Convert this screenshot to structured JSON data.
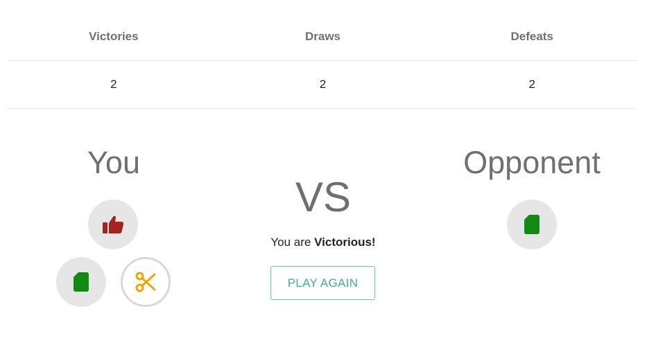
{
  "scoreboard": {
    "headers": [
      "Victories",
      "Draws",
      "Defeats"
    ],
    "values": [
      "2",
      "2",
      "2"
    ]
  },
  "players": {
    "you_title": "You",
    "opponent_title": "Opponent",
    "you_choices": [
      {
        "icon": "thumbs-up-icon",
        "color": "#a3241f"
      },
      {
        "icon": "paper-icon",
        "color": "#138a14"
      },
      {
        "icon": "scissors-icon",
        "color": "#f0a30a"
      }
    ],
    "opponent_choice": {
      "icon": "paper-icon",
      "color": "#138a14"
    }
  },
  "versus_label": "VS",
  "result": {
    "prefix": "You are ",
    "outcome": "Victorious!"
  },
  "play_again_label": "PLAY AGAIN",
  "colors": {
    "accent": "#3fae93",
    "circle_bg": "#e6e6e6",
    "muted_text": "#707070"
  }
}
